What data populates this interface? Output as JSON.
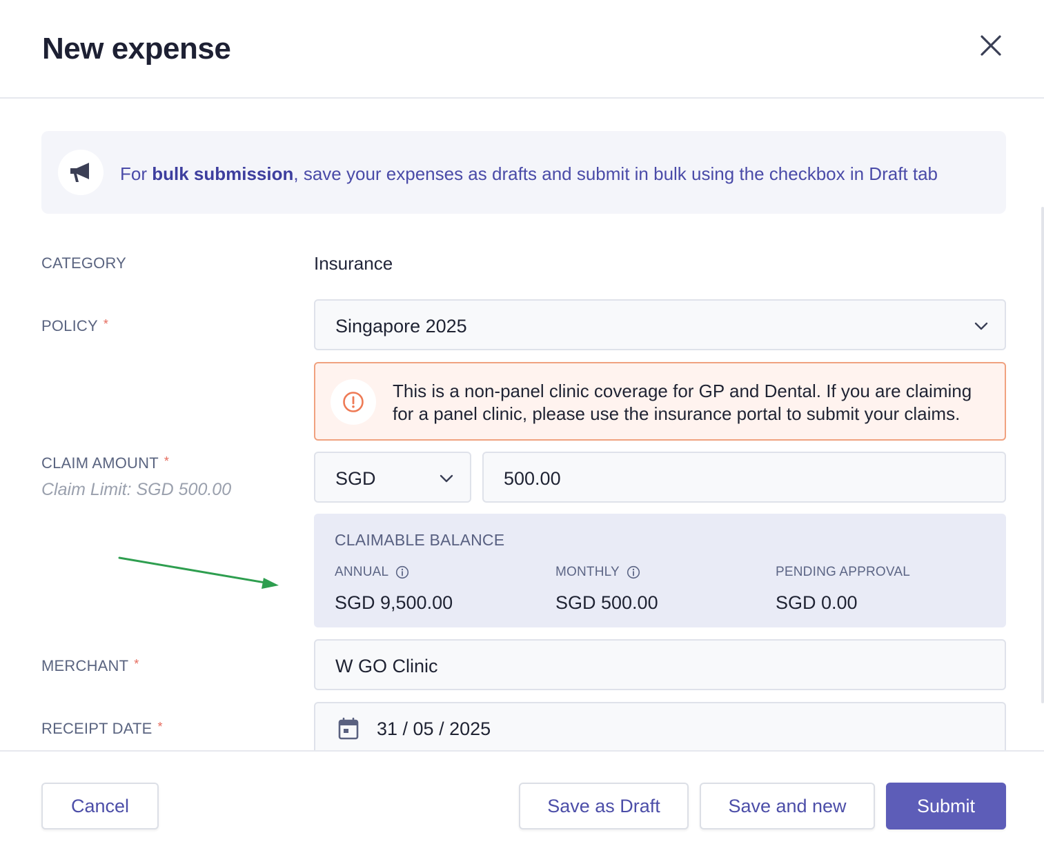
{
  "modal": {
    "title": "New expense"
  },
  "banner": {
    "text_prefix": "For ",
    "text_bold": "bulk submission",
    "text_suffix": ", save your expenses as drafts and submit in bulk using the checkbox in Draft tab",
    "icon": "megaphone-icon"
  },
  "form": {
    "category": {
      "label": "CATEGORY",
      "value": "Insurance"
    },
    "policy": {
      "label": "POLICY",
      "required_mark": "*",
      "value": "Singapore 2025"
    },
    "alert": {
      "text": "This is a non-panel clinic coverage for GP and Dental. If you are claiming for a panel clinic, please use the insurance portal to submit your claims.",
      "icon": "exclamation-circle-icon"
    },
    "claim_amount": {
      "label": "CLAIM AMOUNT",
      "required_mark": "*",
      "limit_text": "Claim Limit: SGD 500.00",
      "currency": "SGD",
      "amount": "500.00"
    },
    "claimable_balance": {
      "title": "CLAIMABLE BALANCE",
      "annual": {
        "label": "ANNUAL",
        "value": "SGD 9,500.00"
      },
      "monthly": {
        "label": "MONTHLY",
        "value": "SGD 500.00"
      },
      "pending": {
        "label": "PENDING APPROVAL",
        "value": "SGD 0.00"
      }
    },
    "merchant": {
      "label": "MERCHANT",
      "required_mark": "*",
      "value": "W GO Clinic"
    },
    "receipt_date": {
      "label": "RECEIPT DATE",
      "required_mark": "*",
      "value": "31 / 05 / 2025"
    }
  },
  "footer": {
    "cancel": "Cancel",
    "save_draft": "Save as Draft",
    "save_new": "Save and new",
    "submit": "Submit"
  },
  "colors": {
    "accent": "#5d5db8",
    "banner_text": "#4a4ba8",
    "alert_border": "#f0a17f",
    "alert_bg": "#fff3ef",
    "required": "#e56b5d",
    "annotation_arrow": "#2e9e4f"
  }
}
